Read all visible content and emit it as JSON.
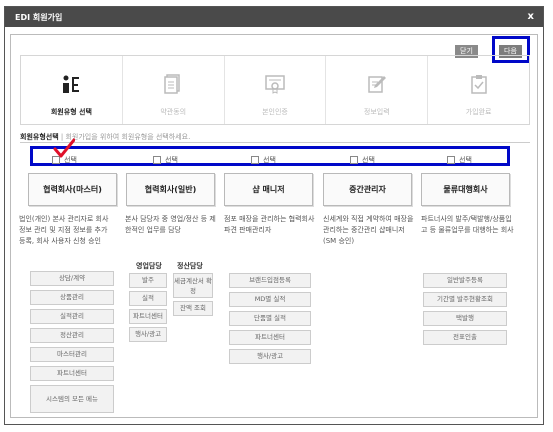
{
  "window": {
    "title": "EDI 회원가입",
    "close_glyph": "x"
  },
  "top_buttons": {
    "close": "닫기",
    "next": "다음"
  },
  "steps": [
    {
      "label": "회원유형 선택",
      "icon": "person-info-icon",
      "active": true
    },
    {
      "label": "약관동의",
      "icon": "document-icon",
      "active": false
    },
    {
      "label": "본인인증",
      "icon": "certificate-icon",
      "active": false
    },
    {
      "label": "정보입력",
      "icon": "write-icon",
      "active": false
    },
    {
      "label": "가입완료",
      "icon": "clipboard-check-icon",
      "active": false
    }
  ],
  "section": {
    "title": "회원유형선택",
    "separator": "|",
    "hint": "회원가입을 위하여 회원유형을 선택하세요."
  },
  "options": [
    {
      "check": "선택",
      "checked": true,
      "title": "협력회사(마스터)",
      "desc": "법인(개인) 본사 관리자로 회사 정보 관리 및 지점 정보를 추가 등록, 회사 사용자 신청 승인"
    },
    {
      "check": "선택",
      "checked": false,
      "title": "협력회사(일반)",
      "desc": "본사 담당자 중 영업/정산 등 제한적인 업무를 담당"
    },
    {
      "check": "선택",
      "checked": false,
      "title": "샵 매니저",
      "desc": "점포 매장을 관리하는 협력회사 파견 판매관리자"
    },
    {
      "check": "선택",
      "checked": false,
      "title": "중간관리자",
      "desc": "신세계와 직접 계약하여 매장을 관리하는 중간관리 샵매니저 (SM 승인)"
    },
    {
      "check": "선택",
      "checked": false,
      "title": "물류대행회사",
      "desc": "파트너사의 발주/택발행/상품입고 등 물류업무를 대행하는 회사"
    }
  ],
  "col1_menu": [
    "상담/계약",
    "상품관리",
    "실적관리",
    "정산관리",
    "마스터관리",
    "파트너센터",
    "시스템의 모든 메뉴"
  ],
  "col2": {
    "sales_head": "영업담당",
    "settle_head": "정산담당",
    "sales_menu": [
      "발주",
      "실적",
      "파트너센터",
      "행사/광고"
    ],
    "settle_menu": [
      "세금계산서 확정",
      "잔액 조회"
    ]
  },
  "col3_menu": [
    "브랜드입점등록",
    "MD별 실적",
    "단품별 실적",
    "파트너센터",
    "행사/광고"
  ],
  "col5_menu": [
    "일반발주등록",
    "기간별 발주현황조회",
    "택발행",
    "전표인출"
  ]
}
